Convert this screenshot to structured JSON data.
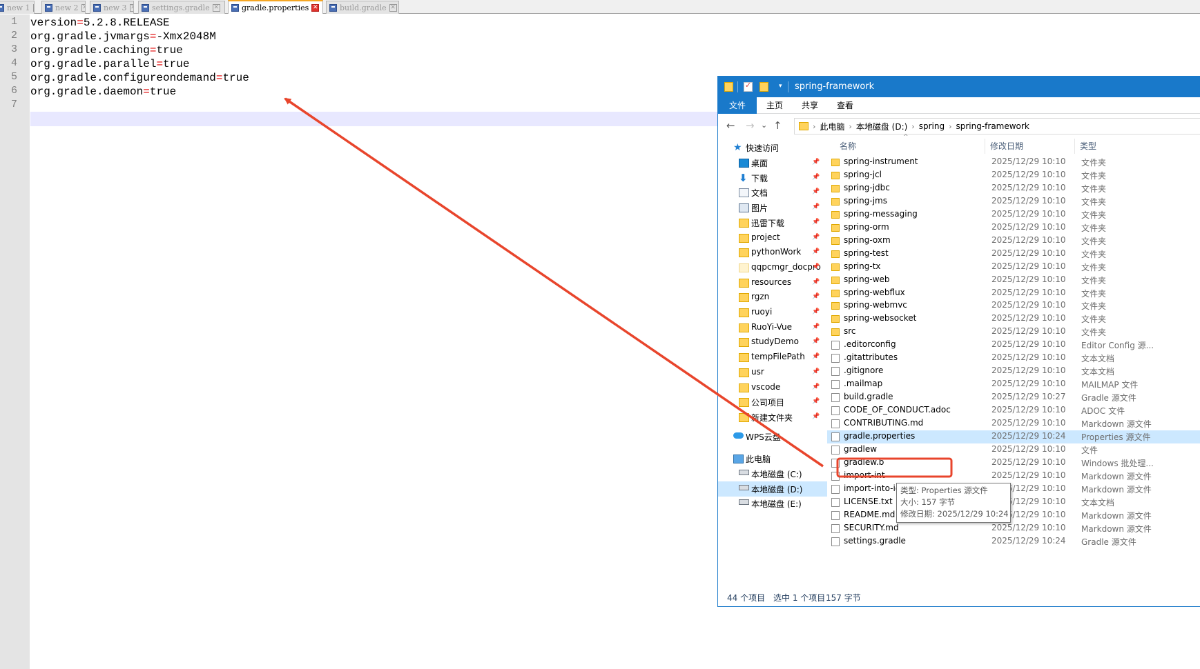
{
  "editor": {
    "tabs": [
      {
        "label": "new 1",
        "active": false
      },
      {
        "label": "new 2",
        "active": false
      },
      {
        "label": "new 3",
        "active": false
      },
      {
        "label": "settings.gradle",
        "active": false
      },
      {
        "label": "gradle.properties",
        "active": true
      },
      {
        "label": "build.gradle",
        "active": false
      }
    ],
    "close_glyph": "✕",
    "lines": [
      {
        "number": "1",
        "key": "version",
        "op": "=",
        "value": "5.2.8.RELEASE"
      },
      {
        "number": "2",
        "key": "org.gradle.jvmargs",
        "op": "=",
        "value": "-Xmx2048M"
      },
      {
        "number": "3",
        "key": "org.gradle.caching",
        "op": "=",
        "value": "true"
      },
      {
        "number": "4",
        "key": "org.gradle.parallel",
        "op": "=",
        "value": "true"
      },
      {
        "number": "5",
        "key": "org.gradle.configureondemand",
        "op": "=",
        "value": "true"
      },
      {
        "number": "6",
        "key": "org.gradle.daemon",
        "op": "=",
        "value": "true"
      },
      {
        "number": "7",
        "key": "",
        "op": "",
        "value": ""
      }
    ],
    "colors": {
      "operator": "#e00000",
      "gutter": "#e4e4e4",
      "current_line": "#e8e8ff"
    }
  },
  "explorer": {
    "title": "spring-framework",
    "ribbon_tabs": [
      "文件",
      "主页",
      "共享",
      "查看"
    ],
    "nav_buttons": {
      "back": "←",
      "forward": "→",
      "recent": "⌄",
      "up": "↑"
    },
    "breadcrumb": [
      "此电脑",
      "本地磁盘 (D:)",
      "spring",
      "spring-framework"
    ],
    "breadcrumb_sep": "›",
    "nav_pane": {
      "quick_access": "快速访问",
      "items": [
        {
          "label": "桌面",
          "icon": "desktop-icon"
        },
        {
          "label": "下载",
          "icon": "download-icon"
        },
        {
          "label": "文档",
          "icon": "documents-icon"
        },
        {
          "label": "图片",
          "icon": "pictures-icon"
        },
        {
          "label": "迅雷下载",
          "icon": "folder-icon"
        },
        {
          "label": "project",
          "icon": "folder-icon"
        },
        {
          "label": "pythonWork",
          "icon": "folder-icon"
        },
        {
          "label": "qqpcmgr_docpro",
          "icon": "folder-icon"
        },
        {
          "label": "resources",
          "icon": "folder-icon"
        },
        {
          "label": "rgzn",
          "icon": "folder-icon"
        },
        {
          "label": "ruoyi",
          "icon": "folder-icon"
        },
        {
          "label": "RuoYi-Vue",
          "icon": "folder-icon"
        },
        {
          "label": "studyDemo",
          "icon": "folder-icon"
        },
        {
          "label": "tempFilePath",
          "icon": "folder-icon"
        },
        {
          "label": "usr",
          "icon": "folder-icon"
        },
        {
          "label": "vscode",
          "icon": "folder-icon"
        },
        {
          "label": "公司项目",
          "icon": "folder-icon"
        },
        {
          "label": "新建文件夹",
          "icon": "folder-icon"
        }
      ],
      "pin_glyph": "📌",
      "wps": "WPS云盘",
      "this_pc": "此电脑",
      "drives": [
        {
          "label": "本地磁盘 (C:)",
          "selected": false
        },
        {
          "label": "本地磁盘 (D:)",
          "selected": true
        },
        {
          "label": "本地磁盘 (E:)",
          "selected": false
        }
      ]
    },
    "columns": {
      "name": "名称",
      "date": "修改日期",
      "type": "类型",
      "sort_glyph": "^"
    },
    "files": [
      {
        "name": "spring-instrument",
        "date": "2025/12/29 10:10",
        "type": "文件夹",
        "kind": "folder"
      },
      {
        "name": "spring-jcl",
        "date": "2025/12/29 10:10",
        "type": "文件夹",
        "kind": "folder"
      },
      {
        "name": "spring-jdbc",
        "date": "2025/12/29 10:10",
        "type": "文件夹",
        "kind": "folder"
      },
      {
        "name": "spring-jms",
        "date": "2025/12/29 10:10",
        "type": "文件夹",
        "kind": "folder"
      },
      {
        "name": "spring-messaging",
        "date": "2025/12/29 10:10",
        "type": "文件夹",
        "kind": "folder"
      },
      {
        "name": "spring-orm",
        "date": "2025/12/29 10:10",
        "type": "文件夹",
        "kind": "folder"
      },
      {
        "name": "spring-oxm",
        "date": "2025/12/29 10:10",
        "type": "文件夹",
        "kind": "folder"
      },
      {
        "name": "spring-test",
        "date": "2025/12/29 10:10",
        "type": "文件夹",
        "kind": "folder"
      },
      {
        "name": "spring-tx",
        "date": "2025/12/29 10:10",
        "type": "文件夹",
        "kind": "folder"
      },
      {
        "name": "spring-web",
        "date": "2025/12/29 10:10",
        "type": "文件夹",
        "kind": "folder"
      },
      {
        "name": "spring-webflux",
        "date": "2025/12/29 10:10",
        "type": "文件夹",
        "kind": "folder"
      },
      {
        "name": "spring-webmvc",
        "date": "2025/12/29 10:10",
        "type": "文件夹",
        "kind": "folder"
      },
      {
        "name": "spring-websocket",
        "date": "2025/12/29 10:10",
        "type": "文件夹",
        "kind": "folder"
      },
      {
        "name": "src",
        "date": "2025/12/29 10:10",
        "type": "文件夹",
        "kind": "folder"
      },
      {
        "name": ".editorconfig",
        "date": "2025/12/29 10:10",
        "type": "Editor Config 源...",
        "kind": "file"
      },
      {
        "name": ".gitattributes",
        "date": "2025/12/29 10:10",
        "type": "文本文档",
        "kind": "file"
      },
      {
        "name": ".gitignore",
        "date": "2025/12/29 10:10",
        "type": "文本文档",
        "kind": "file"
      },
      {
        "name": ".mailmap",
        "date": "2025/12/29 10:10",
        "type": "MAILMAP 文件",
        "kind": "file"
      },
      {
        "name": "build.gradle",
        "date": "2025/12/29 10:27",
        "type": "Gradle 源文件",
        "kind": "file"
      },
      {
        "name": "CODE_OF_CONDUCT.adoc",
        "date": "2025/12/29 10:10",
        "type": "ADOC 文件",
        "kind": "file"
      },
      {
        "name": "CONTRIBUTING.md",
        "date": "2025/12/29 10:10",
        "type": "Markdown 源文件",
        "kind": "file"
      },
      {
        "name": "gradle.properties",
        "date": "2025/12/29 10:24",
        "type": "Properties 源文件",
        "kind": "file",
        "selected": true
      },
      {
        "name": "gradlew",
        "date": "2025/12/29 10:10",
        "type": "文件",
        "kind": "file"
      },
      {
        "name": "gradlew.b",
        "date": "2025/12/29 10:10",
        "type": "Windows 批处理...",
        "kind": "file"
      },
      {
        "name": "import-int",
        "date": "2025/12/29 10:10",
        "type": "Markdown 源文件",
        "kind": "file"
      },
      {
        "name": "import-into-idea.md",
        "date": "2025/12/29 10:10",
        "type": "Markdown 源文件",
        "kind": "file"
      },
      {
        "name": "LICENSE.txt",
        "date": "2025/12/29 10:10",
        "type": "文本文档",
        "kind": "file"
      },
      {
        "name": "README.md",
        "date": "2025/12/29 10:10",
        "type": "Markdown 源文件",
        "kind": "file"
      },
      {
        "name": "SECURITY.md",
        "date": "2025/12/29 10:10",
        "type": "Markdown 源文件",
        "kind": "file"
      },
      {
        "name": "settings.gradle",
        "date": "2025/12/29 10:24",
        "type": "Gradle 源文件",
        "kind": "file"
      }
    ],
    "tooltip": {
      "type_line": "类型: Properties 源文件",
      "size_line": "大小: 157 字节",
      "date_line": "修改日期: 2025/12/29 10:24"
    },
    "status": {
      "count": "44 个项目",
      "selection": "选中 1 个项目",
      "size": "157 字节"
    },
    "colors": {
      "titlebar": "#1979ca",
      "selection": "#cce8ff",
      "folder": "#ffd35c"
    }
  },
  "annotations": {
    "color": "#e8452c"
  }
}
